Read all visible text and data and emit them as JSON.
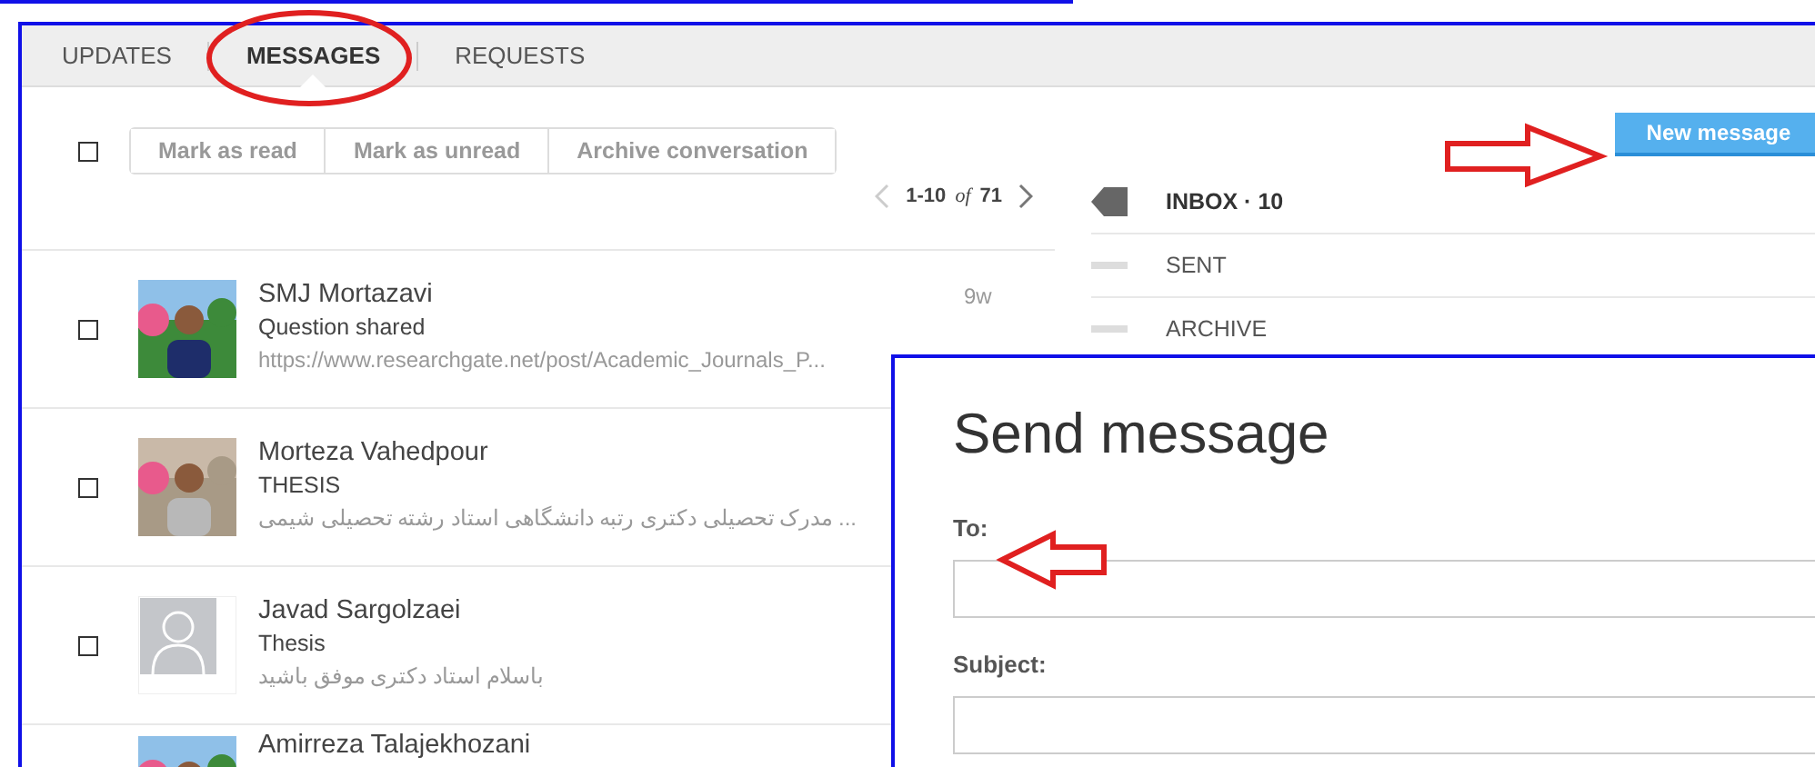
{
  "tabs": [
    {
      "label": "UPDATES",
      "selected": false
    },
    {
      "label": "MESSAGES",
      "selected": true
    },
    {
      "label": "REQUESTS",
      "selected": false
    }
  ],
  "toolbar": {
    "select_all": {
      "checked": false
    },
    "buttons": [
      "Mark as read",
      "Mark as unread",
      "Archive conversation"
    ]
  },
  "pagination": {
    "range": "1-10",
    "of": "of",
    "total": "71"
  },
  "new_message_button": "New message",
  "folders": [
    {
      "label": "INBOX · 10",
      "selected": true
    },
    {
      "label": "SENT",
      "selected": false
    },
    {
      "label": "ARCHIVE",
      "selected": false
    }
  ],
  "conversations": [
    {
      "name": "SMJ Mortazavi",
      "subject": "Question shared",
      "preview": "https://www.researchgate.net/post/Academic_Journals_P...",
      "time": "9w",
      "checked": false
    },
    {
      "name": "Morteza Vahedpour",
      "subject": "THESIS",
      "preview": "مدرک تحصیلی دکتری رتبه دانشگاهی استاد رشته تحصیلی شیمی ...",
      "checked": false
    },
    {
      "name": "Javad Sargolzaei",
      "subject": "Thesis",
      "preview": "باسلام استاد دکتری موفق باشید",
      "checked": false,
      "kind": "placeholder"
    },
    {
      "name": "Amirreza Talajekhozani"
    }
  ],
  "dialog": {
    "title": "Send message",
    "fields": [
      {
        "label": "To:"
      },
      {
        "label": "Subject:"
      }
    ]
  }
}
